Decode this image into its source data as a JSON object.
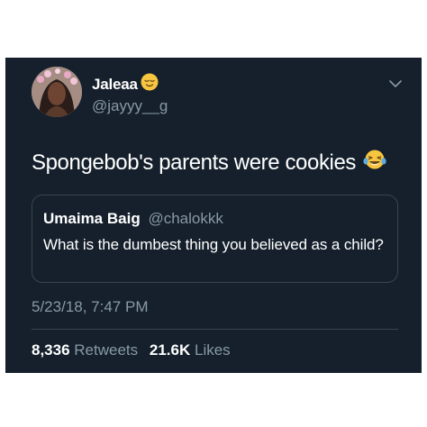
{
  "tweet": {
    "display_name": "Jaleaa",
    "name_emoji": "relieved-face-emoji",
    "handle": "@jayyy__g",
    "text": "Spongebob's parents were cookies",
    "text_emoji": "tears-of-joy-emoji",
    "timestamp": "5/23/18, 7:47 PM",
    "retweets_count": "8,336",
    "retweets_label": "Retweets",
    "likes_count": "21.6K",
    "likes_label": "Likes"
  },
  "quoted_tweet": {
    "name": "Umaima Baig",
    "handle": "@chalokkk",
    "text": "What is the dumbest thing you believed as a child?"
  },
  "colors": {
    "card_background": "#15202c",
    "secondary_text": "#8899a6",
    "border": "#38444d",
    "emoji_yellow": "#f7c540"
  }
}
